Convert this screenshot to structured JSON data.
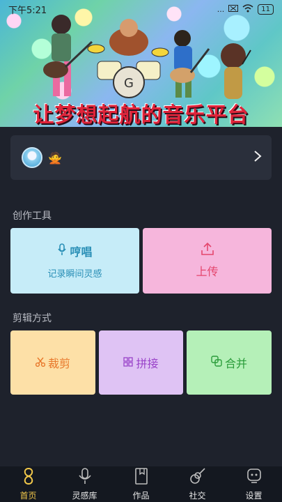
{
  "status_bar": {
    "time": "下午5:21",
    "signal": "...",
    "battery": "11"
  },
  "banner": {
    "title": "让梦想起航的音乐平台"
  },
  "profile": {
    "emoji": "🙅"
  },
  "creation_tools": {
    "section_label": "创作工具",
    "hum": {
      "label": "哼唱",
      "subtitle": "记录瞬间灵感"
    },
    "upload": {
      "label": "上传"
    }
  },
  "edit_methods": {
    "section_label": "剪辑方式",
    "crop": {
      "label": "裁剪"
    },
    "splice": {
      "label": "拼接"
    },
    "merge": {
      "label": "合并"
    }
  },
  "tabs": [
    {
      "label": "首页",
      "icon": "home-icon",
      "active": true
    },
    {
      "label": "灵感库",
      "icon": "microphone-icon",
      "active": false
    },
    {
      "label": "作品",
      "icon": "book-icon",
      "active": false
    },
    {
      "label": "社交",
      "icon": "guitar-icon",
      "active": false
    },
    {
      "label": "设置",
      "icon": "robot-icon",
      "active": false
    }
  ],
  "colors": {
    "background": "#1e222c",
    "active_tab": "#f2c84a",
    "hum": "#2a8fb6",
    "upload": "#e4466d",
    "crop": "#e8772a",
    "splice": "#9a43c9",
    "merge": "#2a9c3a"
  }
}
